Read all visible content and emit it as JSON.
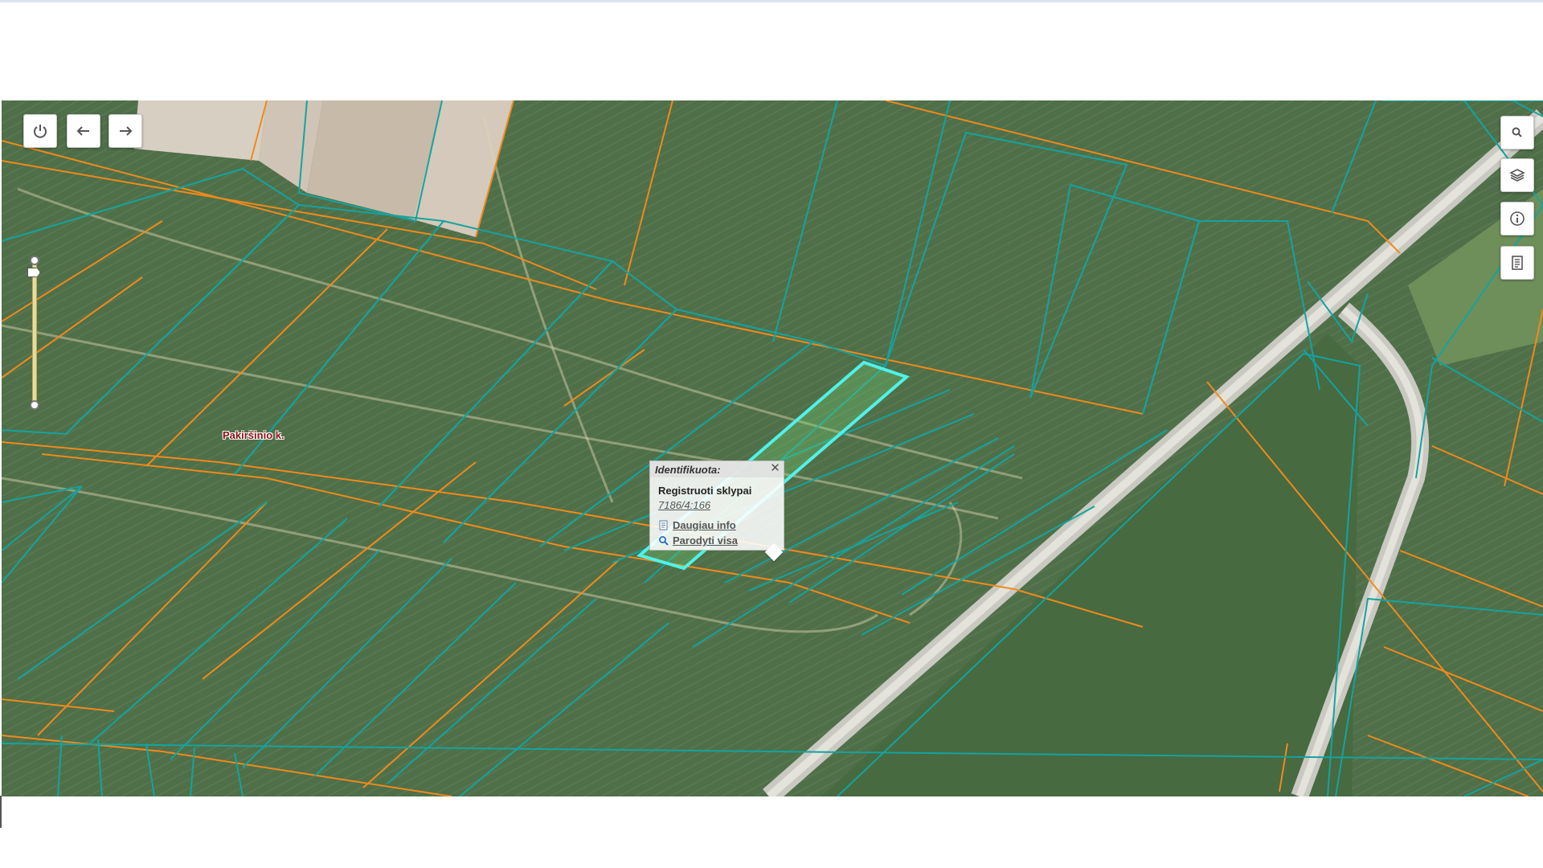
{
  "map": {
    "village_label": "Pakiršinio k.",
    "colors": {
      "field": "#4f6f48",
      "cadastral_line": "#15a3a0",
      "boundary_line": "#f08a1c",
      "selected_outline": "#4ff2e8",
      "road": "#c9c9c2"
    }
  },
  "toolbar": {
    "power_icon": "power-icon",
    "back_icon": "arrow-left-icon",
    "forward_icon": "arrow-right-icon"
  },
  "right_tools": {
    "search_icon": "search-icon",
    "layers_icon": "layers-icon",
    "info_icon": "info-icon",
    "legend_icon": "legend-icon"
  },
  "popup": {
    "title": "Identifikuota:",
    "layer_name": "Registruoti sklypai",
    "parcel_id": "7186/4:166",
    "more_info_label": "Daugiau info",
    "show_all_label": "Parodyti visa",
    "close_glyph": "✕"
  }
}
